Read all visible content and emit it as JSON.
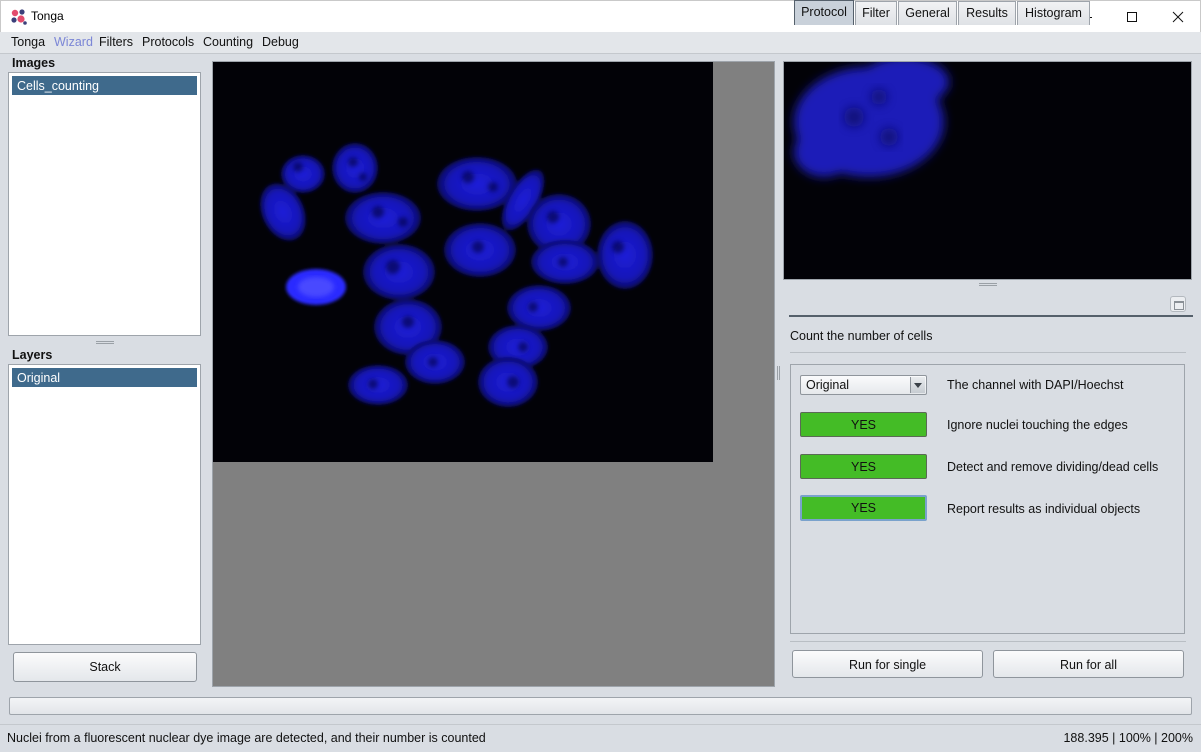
{
  "window": {
    "title": "Tonga",
    "logo_icon": "tonga-logo-icon",
    "controls": [
      "minimize-icon",
      "maximize-icon",
      "close-icon"
    ]
  },
  "menu": {
    "items": [
      "Tonga",
      "Wizard",
      "Filters",
      "Protocols",
      "Counting",
      "Debug"
    ],
    "active": "Wizard",
    "active_color": "#7b86d6"
  },
  "images_panel": {
    "title": "Images",
    "items": [
      "Cells_counting"
    ],
    "selected": "Cells_counting"
  },
  "layers_panel": {
    "title": "Layers",
    "items": [
      "Original"
    ],
    "selected": "Original",
    "stack_button": "Stack"
  },
  "tabs": {
    "items": [
      "Protocol",
      "Filter",
      "General",
      "Results",
      "Histogram"
    ],
    "active": "Protocol"
  },
  "protocol": {
    "title": "Count the number of cells",
    "channel_select": {
      "value": "Original",
      "label": "The channel with DAPI/Hoechst"
    },
    "options": [
      {
        "button": "YES",
        "label": "Ignore nuclei touching the edges"
      },
      {
        "button": "YES",
        "label": "Detect and remove dividing/dead cells"
      },
      {
        "button": "YES",
        "label": "Report results as individual objects"
      }
    ],
    "yes_color": "#44bc26",
    "run_single": "Run for single",
    "run_all": "Run for all"
  },
  "status": {
    "message": "Nuclei from a fluorescent nuclear dye image are detected, and their number is counted",
    "info": "188.395 | 100% | 200%"
  },
  "colors": {
    "selection": "#3f6a8c",
    "nuclei": "#1a1aff",
    "background": "#d9dde3"
  }
}
